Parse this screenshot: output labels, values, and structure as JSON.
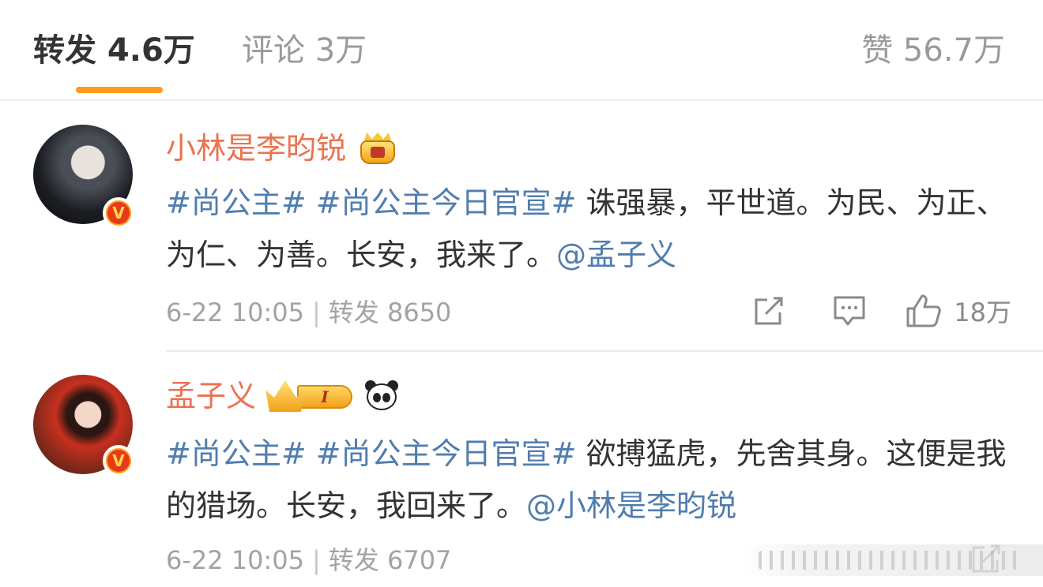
{
  "tabs": {
    "repost": "转发 4.6万",
    "comment": "评论 3万",
    "like": "赞 56.7万"
  },
  "posts": [
    {
      "username": "小林是李昀锐",
      "text": [
        {
          "type": "hashtag",
          "value": "#尚公主#"
        },
        {
          "type": "text",
          "value": " "
        },
        {
          "type": "hashtag",
          "value": "#尚公主今日官宣#"
        },
        {
          "type": "text",
          "value": " 诛强暴，平世道。为民、为正、为仁、为善。长安，我来了。"
        },
        {
          "type": "mention",
          "value": "@孟子义"
        }
      ],
      "time": "6-22 10:05",
      "repost_label": "转发 8650",
      "like_count": "18万",
      "verified_mark": "V"
    },
    {
      "username": "孟子义",
      "text": [
        {
          "type": "hashtag",
          "value": "#尚公主#"
        },
        {
          "type": "text",
          "value": " "
        },
        {
          "type": "hashtag",
          "value": "#尚公主今日官宣#"
        },
        {
          "type": "text",
          "value": " 欲搏猛虎，先舍其身。这便是我的猎场。长安，我回来了。"
        },
        {
          "type": "mention",
          "value": "@小林是李昀锐"
        }
      ],
      "time": "6-22 10:05",
      "repost_label": "转发 6707",
      "vip_level": "I",
      "verified_mark": "V"
    }
  ],
  "meta_separator": "|",
  "colors": {
    "accent_orange": "#ff9a1f",
    "username": "#eb7350",
    "link": "#507daf",
    "muted": "#a3a3a3"
  },
  "icons": [
    "share-icon",
    "comment-icon",
    "thumbs-up-icon"
  ]
}
